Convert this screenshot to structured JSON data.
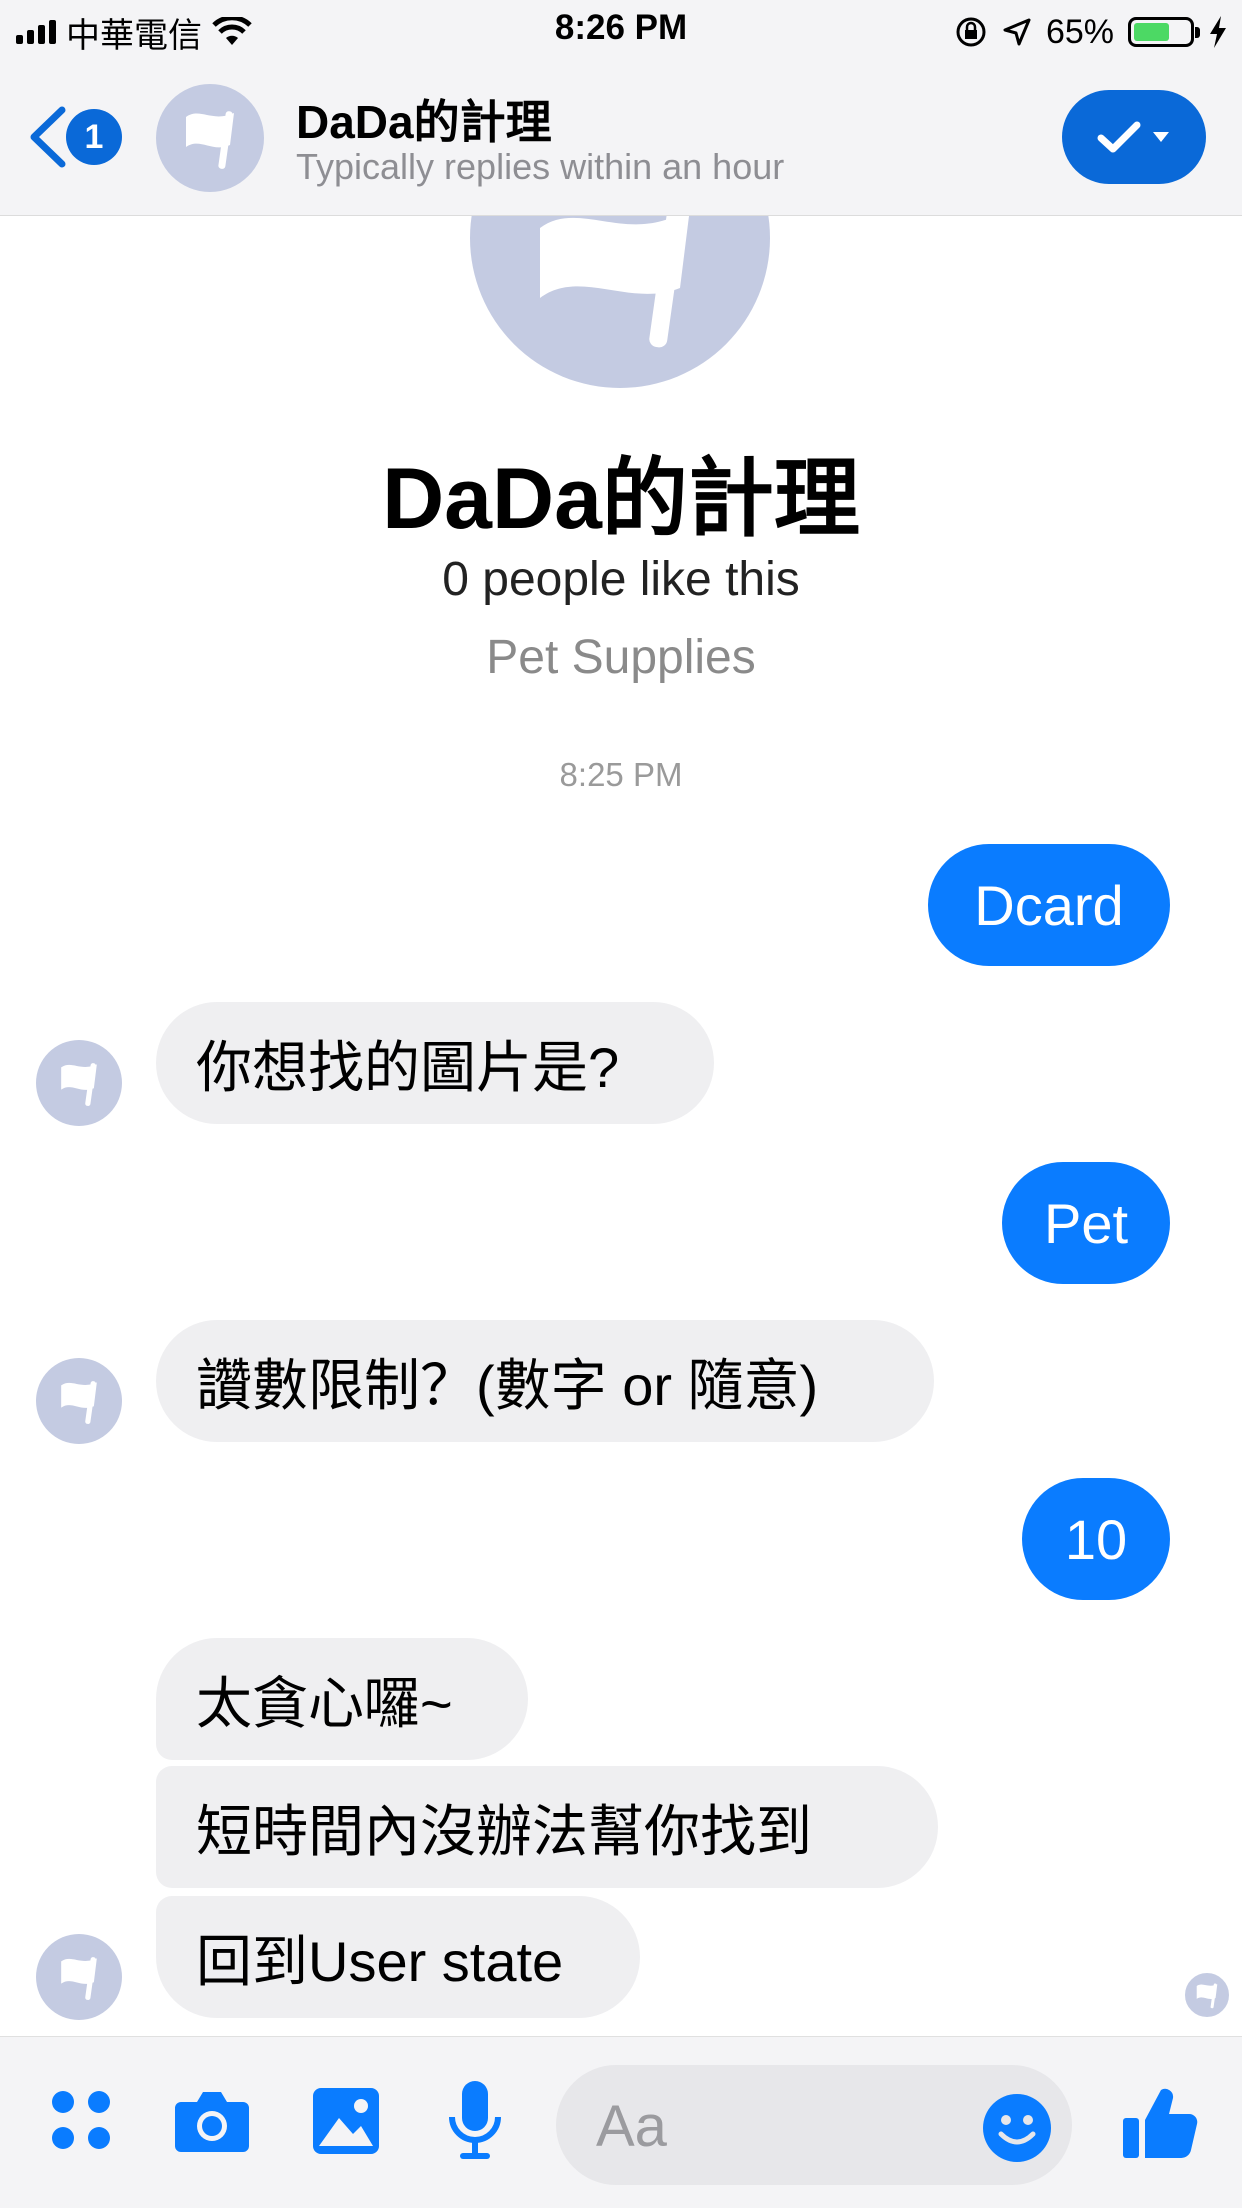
{
  "status_bar": {
    "carrier": "中華電信",
    "time": "8:26 PM",
    "battery_percent": "65%",
    "battery_level": 0.65,
    "icons": [
      "signal-icon",
      "wifi-icon",
      "orientation-lock-icon",
      "location-icon",
      "battery-icon",
      "charging-icon"
    ]
  },
  "header": {
    "back_badge": "1",
    "title": "DaDa的計理",
    "subtitle": "Typically replies within an hour"
  },
  "profile": {
    "name": "DaDa的計理",
    "likes": "0 people like this",
    "category": "Pet Supplies"
  },
  "conversation": {
    "timestamp": "8:25 PM",
    "messages": [
      {
        "from": "me",
        "text": "Dcard"
      },
      {
        "from": "page",
        "text": "你想找的圖片是?"
      },
      {
        "from": "me",
        "text": "Pet"
      },
      {
        "from": "page",
        "text": "讚數限制？(數字 or 隨意)"
      },
      {
        "from": "me",
        "text": "10"
      },
      {
        "from": "page",
        "text": "太貪心囉~"
      },
      {
        "from": "page",
        "text": "短時間內沒辦法幫你找到"
      },
      {
        "from": "page",
        "text": "回到User state"
      }
    ]
  },
  "composer": {
    "placeholder": "Aa",
    "icons": [
      "more-apps-icon",
      "camera-icon",
      "gallery-icon",
      "microphone-icon",
      "emoji-icon",
      "like-icon"
    ]
  },
  "colors": {
    "accent": "#0a7cff",
    "header_blue": "#0a69d8",
    "incoming_bubble": "#efeff1",
    "avatar_placeholder": "#c4cbe2",
    "battery_green": "#4cd964"
  }
}
